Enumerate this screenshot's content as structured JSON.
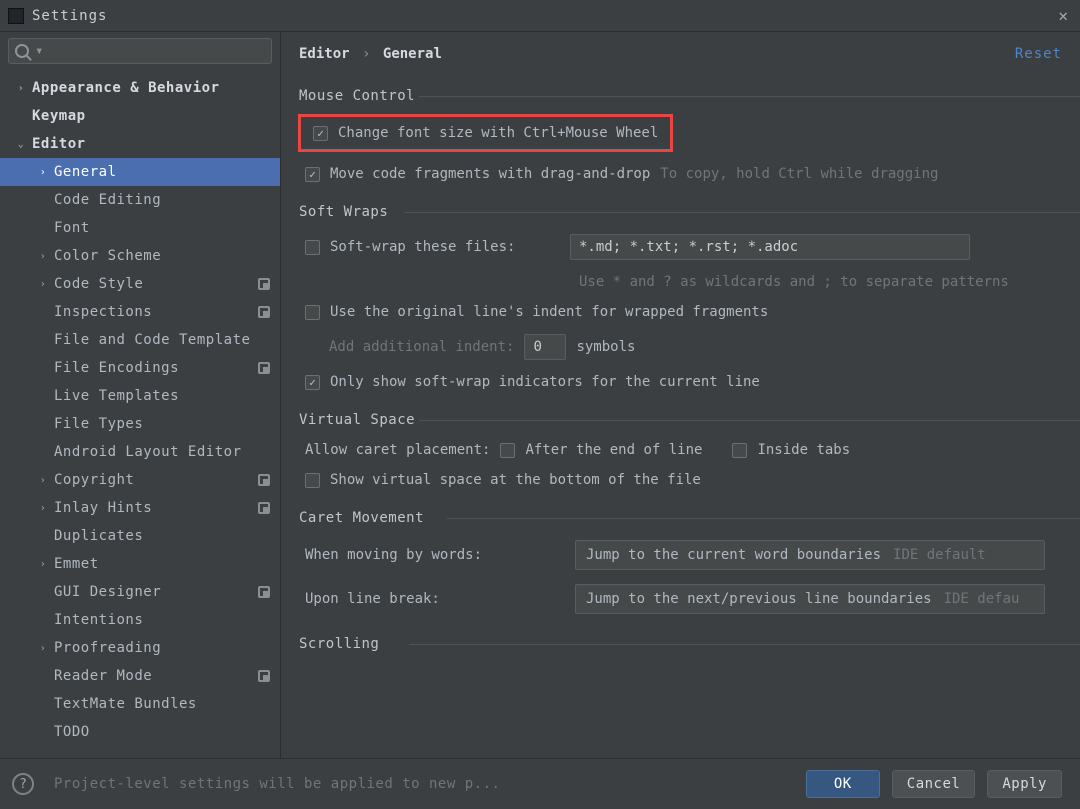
{
  "window": {
    "title": "Settings",
    "close_glyph": "✕"
  },
  "search": {
    "value": "",
    "caret_glyph": "▾"
  },
  "tree": {
    "items": [
      {
        "label": "Appearance & Behavior",
        "level": 0,
        "arrow": "collapsed",
        "bold": true,
        "selected": false,
        "badge": false
      },
      {
        "label": "Keymap",
        "level": 0,
        "arrow": "none",
        "bold": true,
        "selected": false,
        "badge": false
      },
      {
        "label": "Editor",
        "level": 0,
        "arrow": "expanded",
        "bold": true,
        "selected": false,
        "badge": false
      },
      {
        "label": "General",
        "level": 1,
        "arrow": "collapsed",
        "bold": false,
        "selected": true,
        "badge": false
      },
      {
        "label": "Code Editing",
        "level": 1,
        "arrow": "none",
        "bold": false,
        "selected": false,
        "badge": false
      },
      {
        "label": "Font",
        "level": 1,
        "arrow": "none",
        "bold": false,
        "selected": false,
        "badge": false
      },
      {
        "label": "Color Scheme",
        "level": 1,
        "arrow": "collapsed",
        "bold": false,
        "selected": false,
        "badge": false
      },
      {
        "label": "Code Style",
        "level": 1,
        "arrow": "collapsed",
        "bold": false,
        "selected": false,
        "badge": true
      },
      {
        "label": "Inspections",
        "level": 1,
        "arrow": "none",
        "bold": false,
        "selected": false,
        "badge": true
      },
      {
        "label": "File and Code Template",
        "level": 1,
        "arrow": "none",
        "bold": false,
        "selected": false,
        "badge": false
      },
      {
        "label": "File Encodings",
        "level": 1,
        "arrow": "none",
        "bold": false,
        "selected": false,
        "badge": true
      },
      {
        "label": "Live Templates",
        "level": 1,
        "arrow": "none",
        "bold": false,
        "selected": false,
        "badge": false
      },
      {
        "label": "File Types",
        "level": 1,
        "arrow": "none",
        "bold": false,
        "selected": false,
        "badge": false
      },
      {
        "label": "Android Layout Editor",
        "level": 1,
        "arrow": "none",
        "bold": false,
        "selected": false,
        "badge": false
      },
      {
        "label": "Copyright",
        "level": 1,
        "arrow": "collapsed",
        "bold": false,
        "selected": false,
        "badge": true
      },
      {
        "label": "Inlay Hints",
        "level": 1,
        "arrow": "collapsed",
        "bold": false,
        "selected": false,
        "badge": true
      },
      {
        "label": "Duplicates",
        "level": 1,
        "arrow": "none",
        "bold": false,
        "selected": false,
        "badge": false
      },
      {
        "label": "Emmet",
        "level": 1,
        "arrow": "collapsed",
        "bold": false,
        "selected": false,
        "badge": false
      },
      {
        "label": "GUI Designer",
        "level": 1,
        "arrow": "none",
        "bold": false,
        "selected": false,
        "badge": true
      },
      {
        "label": "Intentions",
        "level": 1,
        "arrow": "none",
        "bold": false,
        "selected": false,
        "badge": false
      },
      {
        "label": "Proofreading",
        "level": 1,
        "arrow": "collapsed",
        "bold": false,
        "selected": false,
        "badge": false
      },
      {
        "label": "Reader Mode",
        "level": 1,
        "arrow": "none",
        "bold": false,
        "selected": false,
        "badge": true
      },
      {
        "label": "TextMate Bundles",
        "level": 1,
        "arrow": "none",
        "bold": false,
        "selected": false,
        "badge": false
      },
      {
        "label": "TODO",
        "level": 1,
        "arrow": "none",
        "bold": false,
        "selected": false,
        "badge": false
      }
    ]
  },
  "breadcrumb": {
    "root": "Editor",
    "sep": "›",
    "leaf": "General"
  },
  "reset_label": "Reset",
  "sections": {
    "mouse_control": {
      "title": "Mouse Control",
      "change_font": {
        "checked": true,
        "label": "Change font size with Ctrl+Mouse Wheel"
      },
      "move_frag": {
        "checked": true,
        "label": "Move code fragments with drag-and-drop",
        "hint": "To copy, hold Ctrl while dragging"
      }
    },
    "soft_wraps": {
      "title": "Soft Wraps",
      "wrap_files": {
        "checked": false,
        "label": "Soft-wrap these files:",
        "input": "*.md; *.txt; *.rst; *.adoc",
        "hint": "Use * and ? as wildcards and ; to separate patterns"
      },
      "orig_indent": {
        "checked": false,
        "label": "Use the original line's indent for wrapped fragments"
      },
      "add_indent": {
        "label": "Add additional indent:",
        "value": "0",
        "suffix": "symbols"
      },
      "only_current": {
        "checked": true,
        "label": "Only show soft-wrap indicators for the current line"
      }
    },
    "virtual_space": {
      "title": "Virtual Space",
      "caret_label": "Allow caret placement:",
      "after_eol": {
        "checked": false,
        "label": "After the end of line"
      },
      "inside_tabs": {
        "checked": false,
        "label": "Inside tabs"
      },
      "show_bottom": {
        "checked": false,
        "label": "Show virtual space at the bottom of the file"
      }
    },
    "caret_movement": {
      "title": "Caret Movement",
      "words_label": "When moving by words:",
      "words_value": "Jump to the current word boundaries",
      "words_hint": "IDE default",
      "break_label": "Upon line break:",
      "break_value": "Jump to the next/previous line boundaries",
      "break_hint": "IDE defau"
    },
    "scrolling": {
      "title": "Scrolling"
    }
  },
  "footer": {
    "help_glyph": "?",
    "text": "Project-level settings will be applied to new p...",
    "ok": "OK",
    "cancel": "Cancel",
    "apply": "Apply"
  },
  "glyphs": {
    "arrow_collapsed": "›",
    "arrow_expanded": "⌄"
  }
}
